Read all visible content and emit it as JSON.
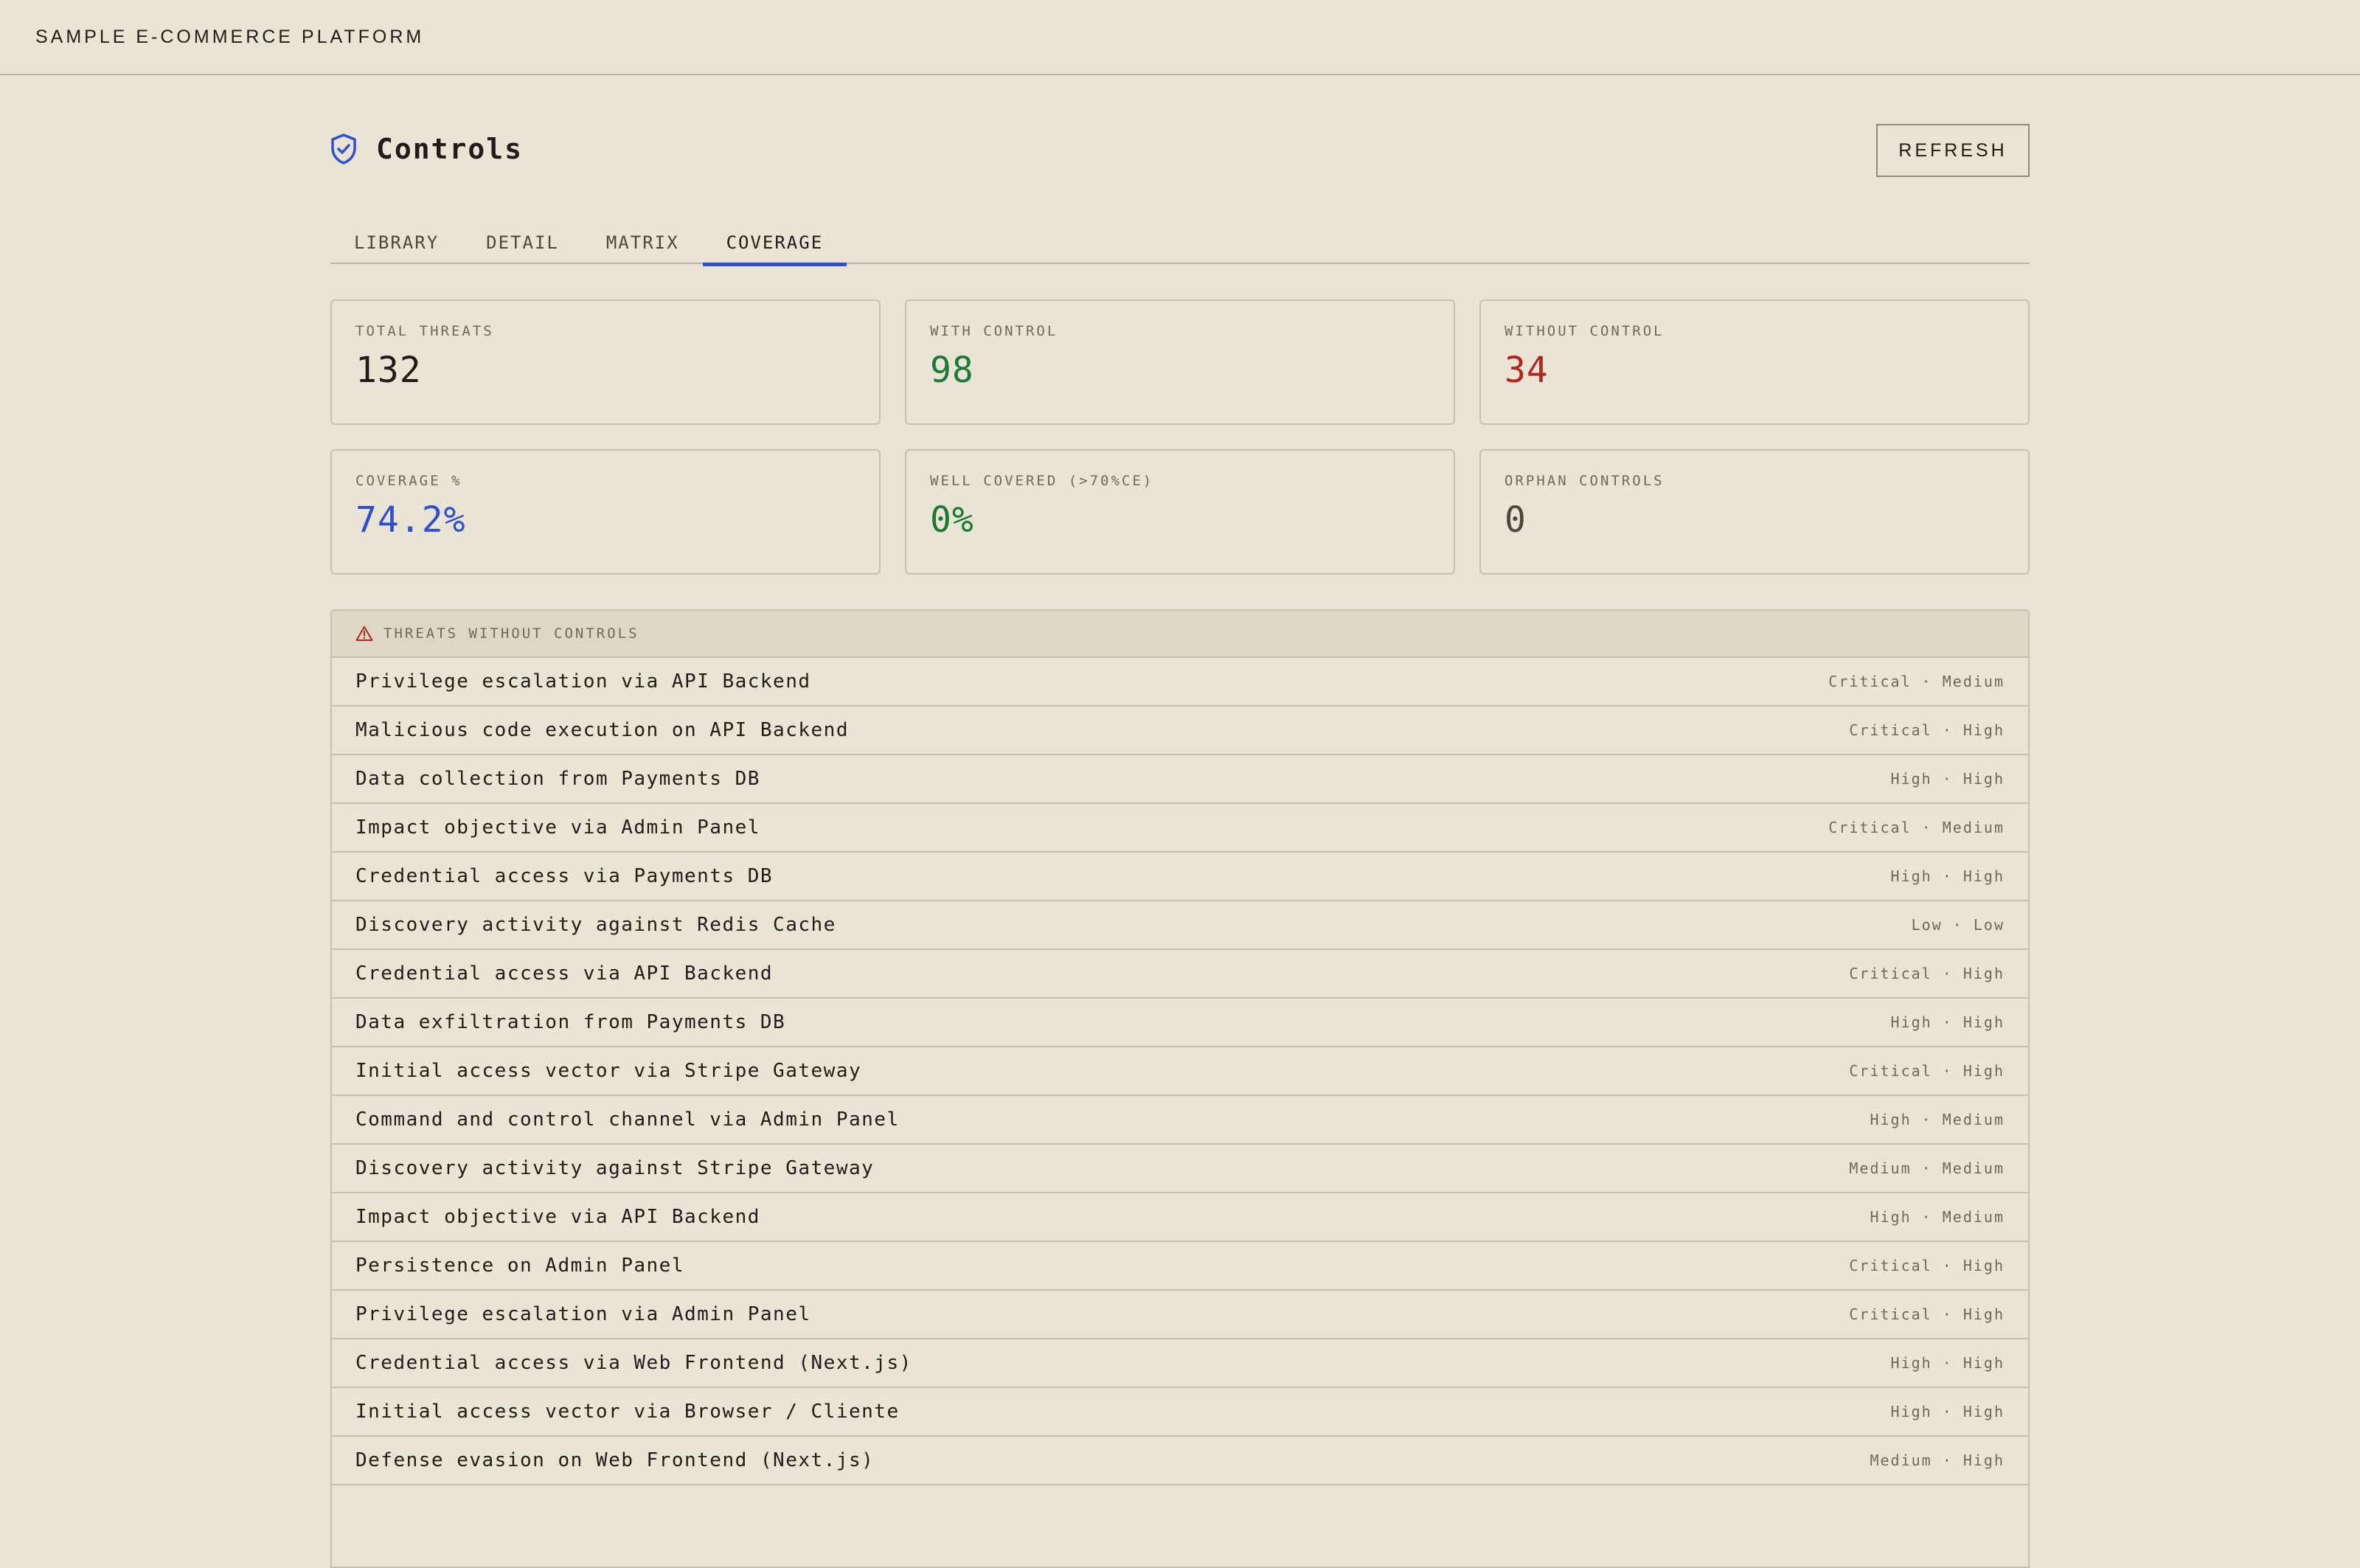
{
  "app": {
    "brand": "SAMPLE E-COMMERCE PLATFORM"
  },
  "header": {
    "title": "Controls",
    "refresh_label": "REFRESH",
    "icon": "shield-check-icon"
  },
  "tabs": [
    {
      "label": "LIBRARY",
      "active": false
    },
    {
      "label": "DETAIL",
      "active": false
    },
    {
      "label": "MATRIX",
      "active": false
    },
    {
      "label": "COVERAGE",
      "active": true
    }
  ],
  "stats": [
    {
      "label": "TOTAL THREATS",
      "value": "132"
    },
    {
      "label": "WITH CONTROL",
      "value": "98"
    },
    {
      "label": "WITHOUT CONTROL",
      "value": "34"
    },
    {
      "label": "COVERAGE %",
      "value": "74.2%"
    },
    {
      "label": "WELL COVERED (>70%CE)",
      "value": "0%"
    },
    {
      "label": "ORPHAN CONTROLS",
      "value": "0"
    }
  ],
  "colors": {
    "accent": "#2e4fd0",
    "green": "#1a7a36",
    "red": "#b3261e",
    "background": "#eae4d5"
  },
  "threats_panel": {
    "title": "THREATS WITHOUT CONTROLS",
    "icon": "warning-triangle-icon",
    "rows": [
      {
        "name": "Privilege escalation via API Backend",
        "meta": "Critical · Medium"
      },
      {
        "name": "Malicious code execution on API Backend",
        "meta": "Critical · High"
      },
      {
        "name": "Data collection from Payments DB",
        "meta": "High · High"
      },
      {
        "name": "Impact objective via Admin Panel",
        "meta": "Critical · Medium"
      },
      {
        "name": "Credential access via Payments DB",
        "meta": "High · High"
      },
      {
        "name": "Discovery activity against Redis Cache",
        "meta": "Low · Low"
      },
      {
        "name": "Credential access via API Backend",
        "meta": "Critical · High"
      },
      {
        "name": "Data exfiltration from Payments DB",
        "meta": "High · High"
      },
      {
        "name": "Initial access vector via Stripe Gateway",
        "meta": "Critical · High"
      },
      {
        "name": "Command and control channel via Admin Panel",
        "meta": "High · Medium"
      },
      {
        "name": "Discovery activity against Stripe Gateway",
        "meta": "Medium · Medium"
      },
      {
        "name": "Impact objective via API Backend",
        "meta": "High · Medium"
      },
      {
        "name": "Persistence on Admin Panel",
        "meta": "Critical · High"
      },
      {
        "name": "Privilege escalation via Admin Panel",
        "meta": "Critical · High"
      },
      {
        "name": "Credential access via Web Frontend (Next.js)",
        "meta": "High · High"
      },
      {
        "name": "Initial access vector via Browser / Cliente",
        "meta": "High · High"
      },
      {
        "name": "Defense evasion on Web Frontend (Next.js)",
        "meta": "Medium · High"
      }
    ]
  }
}
